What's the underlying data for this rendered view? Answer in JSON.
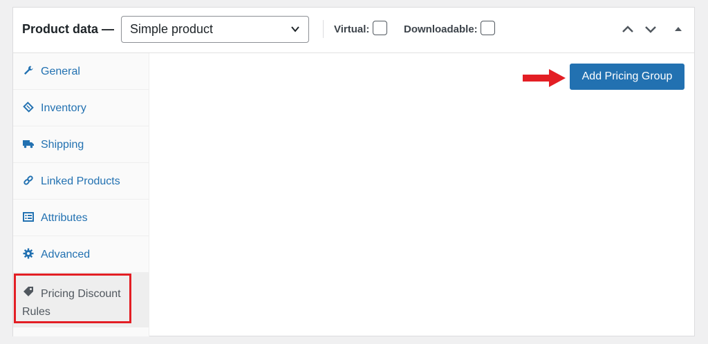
{
  "header": {
    "title": "Product data —",
    "product_type": {
      "selected": "Simple product"
    },
    "virtual_label": "Virtual:",
    "virtual_checked": false,
    "downloadable_label": "Downloadable:",
    "downloadable_checked": false
  },
  "sidebar": {
    "items": [
      {
        "label": "General",
        "icon": "wrench-icon"
      },
      {
        "label": "Inventory",
        "icon": "inventory-tag-icon"
      },
      {
        "label": "Shipping",
        "icon": "truck-icon"
      },
      {
        "label": "Linked Products",
        "icon": "link-icon"
      },
      {
        "label": "Attributes",
        "icon": "list-icon"
      },
      {
        "label": "Advanced",
        "icon": "gear-icon"
      },
      {
        "label": "Pricing Discount Rules",
        "icon": "price-tag-icon",
        "active": true
      }
    ]
  },
  "main": {
    "add_button_label": "Add Pricing Group"
  },
  "colors": {
    "accent": "#2271b1",
    "highlight": "#e31e24",
    "panel_bg": "#ffffff",
    "page_bg": "#f0f0f1"
  }
}
